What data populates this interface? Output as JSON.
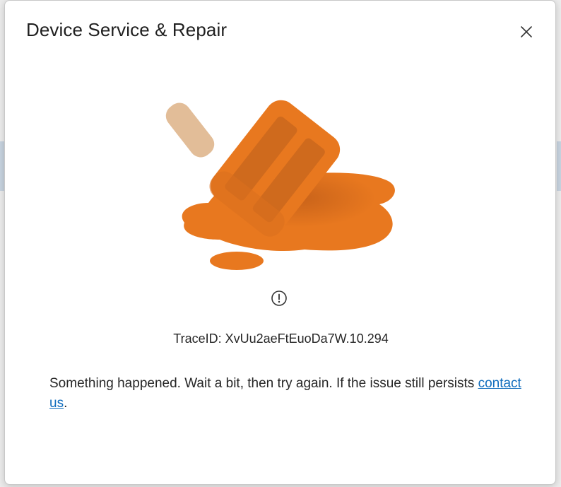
{
  "dialog": {
    "title": "Device Service & Repair",
    "close_icon": "close-icon",
    "illustration_icon": "melted-popsicle-illustration",
    "info_icon": "info-circle-icon",
    "trace_label": "TraceID: XvUu2aeFtEuoDa7W.10.294",
    "message_text": "Something happened. Wait a bit, then try again. If the issue still persists ",
    "link_text": "contact us",
    "message_end": "."
  },
  "colors": {
    "accent_orange": "#e8781f",
    "stick": "#e2bd98",
    "link": "#0f6cbd"
  }
}
